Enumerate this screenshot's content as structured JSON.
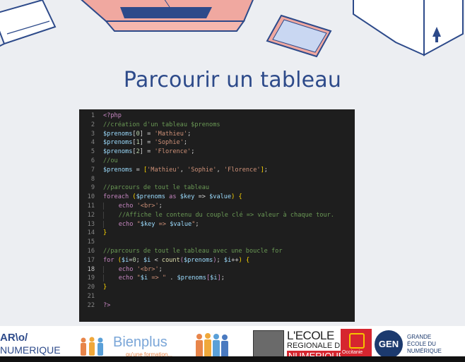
{
  "slide": {
    "title": "Parcourir un tableau"
  },
  "code_lines": [
    {
      "n": "1",
      "html": "<span class='k'>&lt;?php</span>"
    },
    {
      "n": "2",
      "html": "<span class='c'>//création d'un tableau $prenoms</span>"
    },
    {
      "n": "3",
      "html": "<span class='v'>$prenoms</span><span class='p'>[</span><span class='n'>0</span><span class='p'>] = </span><span class='s'>'Mathieu'</span><span class='p'>;</span>"
    },
    {
      "n": "4",
      "html": "<span class='v'>$prenoms</span><span class='p'>[</span><span class='n'>1</span><span class='p'>] = </span><span class='s'>'Sophie'</span><span class='p'>;</span>"
    },
    {
      "n": "5",
      "html": "<span class='v'>$prenoms</span><span class='p'>[</span><span class='n'>2</span><span class='p'>] = </span><span class='s'>'Florence'</span><span class='p'>;</span>"
    },
    {
      "n": "6",
      "html": "<span class='c'>//ou</span>"
    },
    {
      "n": "7",
      "html": "<span class='v'>$prenoms</span><span class='p'> = </span><span class='b'>[</span><span class='s'>'Mathieu'</span><span class='p'>, </span><span class='s'>'Sophie'</span><span class='p'>, </span><span class='s'>'Florence'</span><span class='b'>]</span><span class='p'>;</span>"
    },
    {
      "n": "8",
      "html": ""
    },
    {
      "n": "9",
      "html": "<span class='c'>//parcours de tout le tableau</span>"
    },
    {
      "n": "10",
      "html": "<span class='k'>foreach</span><span class='p'> </span><span class='b'>(</span><span class='v'>$prenoms</span><span class='k'> as </span><span class='v'>$key</span><span class='p'> =&gt; </span><span class='v'>$value</span><span class='b'>)</span><span class='p'> </span><span class='b'>{</span>"
    },
    {
      "n": "11",
      "html": "<span class='guide'>    </span><span class='k'>echo</span><span class='p'> </span><span class='s'>'&lt;br&gt;'</span><span class='p'>;</span>"
    },
    {
      "n": "12",
      "html": "<span class='guide'>    </span><span class='c'>//Affiche le contenu du couple clé =&gt; valeur à chaque tour.</span>"
    },
    {
      "n": "13",
      "html": "<span class='guide'>    </span><span class='k'>echo</span><span class='p'> </span><span class='s'>\"</span><span class='v'>$key</span><span class='s'> =&gt; </span><span class='v'>$value</span><span class='s'>\"</span><span class='p'>;</span>"
    },
    {
      "n": "14",
      "html": "<span class='b'>}</span>"
    },
    {
      "n": "15",
      "html": ""
    },
    {
      "n": "16",
      "html": "<span class='c'>//parcours de tout le tableau avec une boucle for</span>"
    },
    {
      "n": "17",
      "html": "<span class='k'>for</span><span class='p'> </span><span class='b'>(</span><span class='v'>$i</span><span class='p'>=</span><span class='n'>0</span><span class='p'>; </span><span class='v'>$i</span><span class='p'> &lt; </span><span class='f'>count</span><span class='k'>(</span><span class='v'>$prenoms</span><span class='k'>)</span><span class='p'>; </span><span class='v'>$i</span><span class='p'>++</span><span class='b'>)</span><span class='p'> </span><span class='b'>{</span>"
    },
    {
      "n": "18",
      "html": "<span class='guide'>    </span><span class='k'>echo</span><span class='p'> </span><span class='s'>'&lt;br&gt;'</span><span class='p'>;</span>",
      "active": true
    },
    {
      "n": "19",
      "html": "<span class='guide'>    </span><span class='k'>echo</span><span class='p'> </span><span class='s'>\"</span><span class='v'>$i</span><span class='s'> =&gt; \"</span><span class='p'> . </span><span class='v'>$prenoms</span><span class='k'>[</span><span class='v'>$i</span><span class='k'>]</span><span class='p'>;</span>"
    },
    {
      "n": "20",
      "html": "<span class='b'>}</span>"
    },
    {
      "n": "21",
      "html": ""
    },
    {
      "n": "22",
      "html": "<span class='k'>?&gt;</span>"
    }
  ],
  "footer": {
    "logo1_line1": "AR\\o/",
    "logo1_line2": "NUMERIQUE",
    "logo2_main": "Bienplus",
    "logo2_sub": "qu'une formation...",
    "logo3_line1": "L'ECOLE",
    "logo3_line2": "REGIONALE DU",
    "logo3_line3": "NUMERIQUE",
    "region_badge": "Occitanie",
    "gen_logo": "GEN",
    "gen_line1": "GRANDE",
    "gen_line2": "ÉCOLE DU",
    "gen_line3": "NUMÉRIQUE"
  },
  "colors": {
    "title": "#2d4a8a",
    "editor_bg": "#1e1e1e",
    "slide_bg": "#eceef2"
  }
}
